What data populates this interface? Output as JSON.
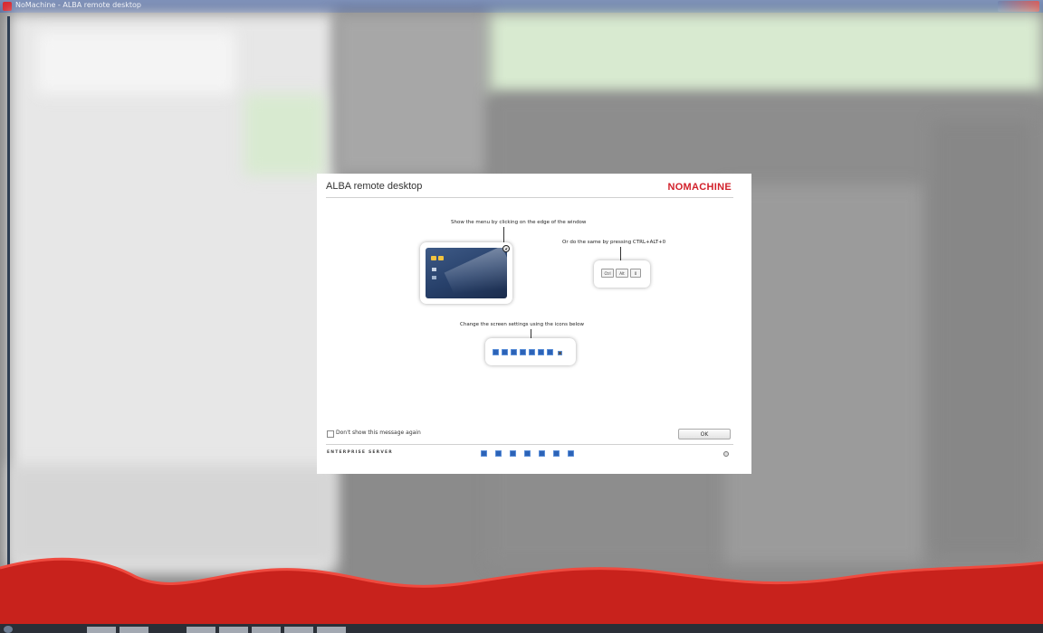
{
  "window": {
    "title": "NoMachine - ALBA remote desktop"
  },
  "dialog": {
    "title": "ALBA remote desktop",
    "brand": "NOMACHINE",
    "menu_hint": "Show the menu by clicking on the edge of the window",
    "shortcut_hint": "Or do the same by pressing CTRL+ALT+0",
    "keys": [
      "Ctrl",
      "Alt",
      "0"
    ],
    "screen_settings_hint": "Change the screen settings using the icons below",
    "dont_show_label": "Don't show this message again",
    "ok_label": "OK",
    "edition": "ENTERPRISE SERVER"
  },
  "colors": {
    "brand_red": "#d2212b",
    "wave_red": "#c8221c",
    "icon_blue": "#2c63b7"
  }
}
